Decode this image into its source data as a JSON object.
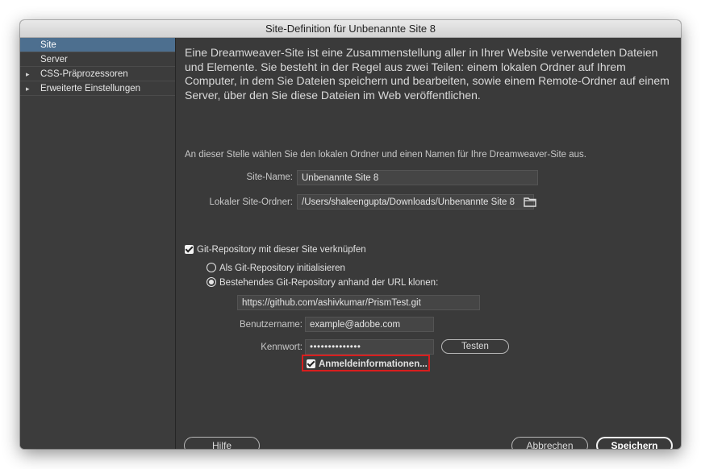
{
  "window": {
    "title": "Site-Definition für Unbenannte Site 8"
  },
  "sidebar": {
    "items": [
      {
        "label": "Site",
        "active": true,
        "expandable": false
      },
      {
        "label": "Server",
        "active": false,
        "expandable": false
      },
      {
        "label": "CSS-Präprozessoren",
        "active": false,
        "expandable": true
      },
      {
        "label": "Erweiterte Einstellungen",
        "active": false,
        "expandable": true
      }
    ]
  },
  "main": {
    "intro": "Eine Dreamweaver-Site ist eine Zusammenstellung aller in Ihrer Website verwendeten Dateien und Elemente. Sie besteht in der Regel aus zwei Teilen: einem lokalen Ordner auf Ihrem Computer, in dem Sie Dateien speichern und bearbeiten, sowie einem Remote-Ordner auf einem Server, über den Sie diese Dateien im Web veröffentlichen.",
    "hint": "An dieser Stelle wählen Sie den lokalen Ordner und einen Namen für Ihre Dreamweaver-Site aus.",
    "site_name_label": "Site-Name:",
    "site_name_value": "Unbenannte Site 8",
    "local_folder_label": "Lokaler Site-Ordner:",
    "local_folder_value": "/Users/shaleengupta/Downloads/Unbenannte Site 8",
    "folder_icon": "folder-icon"
  },
  "git": {
    "link_checkbox_label": "Git-Repository mit dieser Site verknüpfen",
    "link_checked": true,
    "radio_init_label": "Als Git-Repository initialisieren",
    "radio_clone_label": "Bestehendes Git-Repository anhand der URL klonen:",
    "selected_option": "clone",
    "url_value": "https://github.com/ashivkumar/PrismTest.git",
    "username_label": "Benutzername:",
    "username_value": "example@adobe.com",
    "password_label": "Kennwort:",
    "password_value": "••••••••••••••",
    "test_button": "Testen",
    "save_credentials_label": "Anmeldeinformationen...",
    "save_credentials_checked": true
  },
  "footer": {
    "help_button": "Hilfe",
    "cancel_button": "Abbrechen",
    "save_button": "Speichern"
  },
  "colors": {
    "window_bg": "#3a3a3a",
    "sidebar_active": "#4d6f8f",
    "highlight_border": "#d81e1e"
  }
}
